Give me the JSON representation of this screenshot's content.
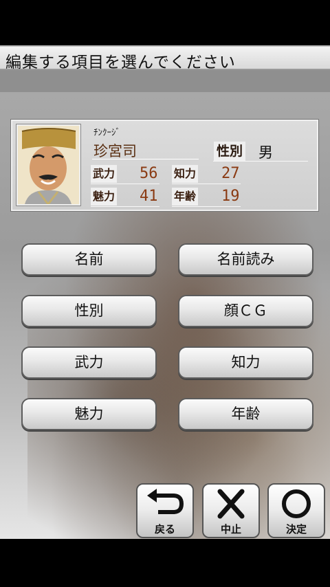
{
  "instruction": "編集する項目を選んでください",
  "character": {
    "reading": "ﾁﾝｸｰｼﾞ",
    "name": "珍宮司",
    "gender_label": "性別",
    "gender": "男",
    "stats": {
      "bu_label": "武力",
      "bu": "56",
      "chi_label": "知力",
      "chi": "27",
      "mi_label": "魅力",
      "mi": "41",
      "age_label": "年齢",
      "age": "19"
    }
  },
  "buttons": [
    {
      "label": "名前"
    },
    {
      "label": "名前読み"
    },
    {
      "label": "性別"
    },
    {
      "label": "顔ＣＧ"
    },
    {
      "label": "武力"
    },
    {
      "label": "知力"
    },
    {
      "label": "魅力"
    },
    {
      "label": "年齢"
    }
  ],
  "actions": {
    "back": "戻る",
    "cancel": "中止",
    "confirm": "決定"
  }
}
